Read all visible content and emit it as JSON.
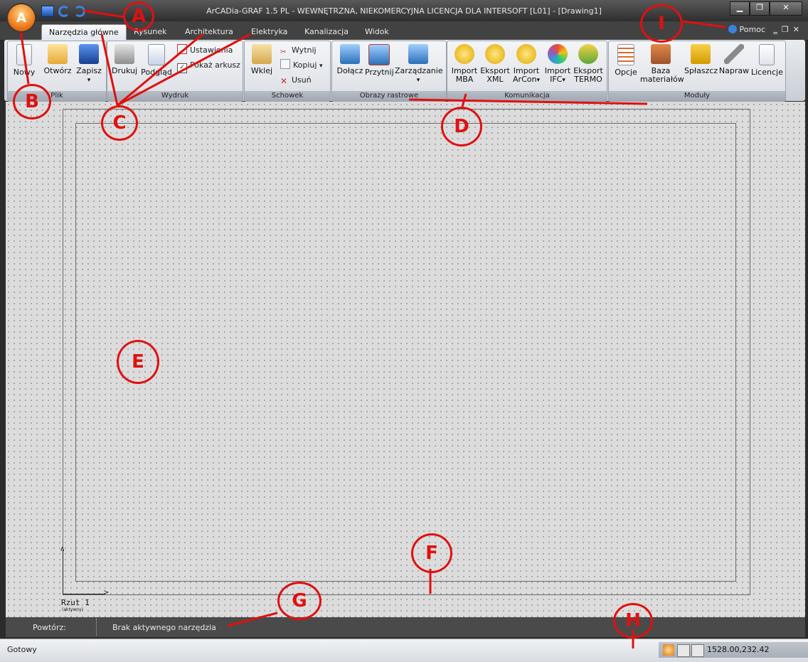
{
  "window": {
    "title": "ArCADia-GRAF 1.5 PL - WEWNĘTRZNA, NIEKOMERCYJNA LICENCJA DLA INTERSOFT [L01] - [Drawing1]",
    "controls": {
      "minimize": "▁",
      "restore": "❐",
      "close": "✕"
    }
  },
  "app_button": {
    "glyph": "A"
  },
  "quick_access": [
    {
      "icon": "save-icon"
    },
    {
      "icon": "undo-icon"
    },
    {
      "icon": "redo-icon"
    }
  ],
  "tabs": [
    {
      "label": "Narzędzia główne",
      "active": true
    },
    {
      "label": "Rysunek"
    },
    {
      "label": "Architektura"
    },
    {
      "label": "Elektryka"
    },
    {
      "label": "Kanalizacja"
    },
    {
      "label": "Widok"
    }
  ],
  "help": {
    "label": "Pomoc",
    "icon": "help-icon"
  },
  "mdi": {
    "minimize": "‗",
    "restore": "❐",
    "close": "✕"
  },
  "ribbon": {
    "groups": [
      {
        "label": "Plik",
        "buttons": [
          {
            "label": "Nowy",
            "icon": "new-file-icon"
          },
          {
            "label": "Otwórz",
            "icon": "open-folder-icon"
          },
          {
            "label": "Zapisz",
            "icon": "save-icon",
            "dropdown": "▾"
          }
        ]
      },
      {
        "label": "Wydruk",
        "buttons": [
          {
            "label": "Drukuj",
            "icon": "printer-icon"
          },
          {
            "label": "Podgląd",
            "icon": "preview-icon"
          }
        ],
        "small": [
          {
            "label": "Ustawienia",
            "icon": "settings-icon"
          },
          {
            "label": "Pokaż arkusz",
            "icon": "checkbox-icon",
            "checked": true
          }
        ]
      },
      {
        "label": "Schowek",
        "buttons": [
          {
            "label": "Wklej",
            "icon": "paste-icon"
          }
        ],
        "small": [
          {
            "label": "Wytnij",
            "icon": "cut-icon"
          },
          {
            "label": "Kopiuj",
            "icon": "copy-icon",
            "dropdown": "▾"
          },
          {
            "label": "Usuń",
            "icon": "delete-icon"
          }
        ]
      },
      {
        "label": "Obrazy rastrowe",
        "buttons": [
          {
            "label": "Dołącz",
            "icon": "attach-image-icon"
          },
          {
            "label": "Przytnij",
            "icon": "crop-image-icon"
          },
          {
            "label": "Zarządzanie",
            "icon": "manage-images-icon",
            "dropdown": "▾"
          }
        ]
      },
      {
        "label": "Komunikacja",
        "buttons": [
          {
            "label": "Import MBA",
            "line1": "Import",
            "line2": "MBA",
            "icon": "mba-icon"
          },
          {
            "label": "Eksport XML",
            "line1": "Eksport",
            "line2": "XML",
            "icon": "xml-icon"
          },
          {
            "label": "Import ArCon",
            "line1": "Import",
            "line2": "ArCon",
            "icon": "arcon-icon",
            "dropdown": "▾"
          },
          {
            "label": "Import IFC",
            "line1": "Import",
            "line2": "IFC",
            "icon": "ifc-icon",
            "dropdown": "▾"
          },
          {
            "label": "Eksport TERMO",
            "line1": "Eksport",
            "line2": "TERMO",
            "icon": "termo-icon"
          }
        ]
      },
      {
        "label": "Moduły",
        "buttons": [
          {
            "label": "Opcje",
            "icon": "options-icon"
          },
          {
            "label": "Baza materiałów",
            "line1": "Baza",
            "line2": "materiałów",
            "icon": "materials-icon"
          },
          {
            "label": "Spłaszcz",
            "icon": "flatten-icon"
          },
          {
            "label": "Napraw",
            "icon": "repair-icon"
          },
          {
            "label": "Licencje",
            "icon": "license-icon"
          }
        ]
      }
    ]
  },
  "canvas": {
    "view_label": "Rzut 1",
    "view_sublabel": "(aktywny)"
  },
  "command_bar": {
    "repeat_label": "Powtórz:",
    "tool_text": "Brak aktywnego narzędzia"
  },
  "status_bar": {
    "text": "Gotowy",
    "coordinates": "1528.00,232.42"
  },
  "annotations": [
    "A",
    "B",
    "C",
    "D",
    "E",
    "F",
    "G",
    "H",
    "I"
  ],
  "colors": {
    "annotation": "#e01010",
    "app_orb": "#f07b1b"
  }
}
